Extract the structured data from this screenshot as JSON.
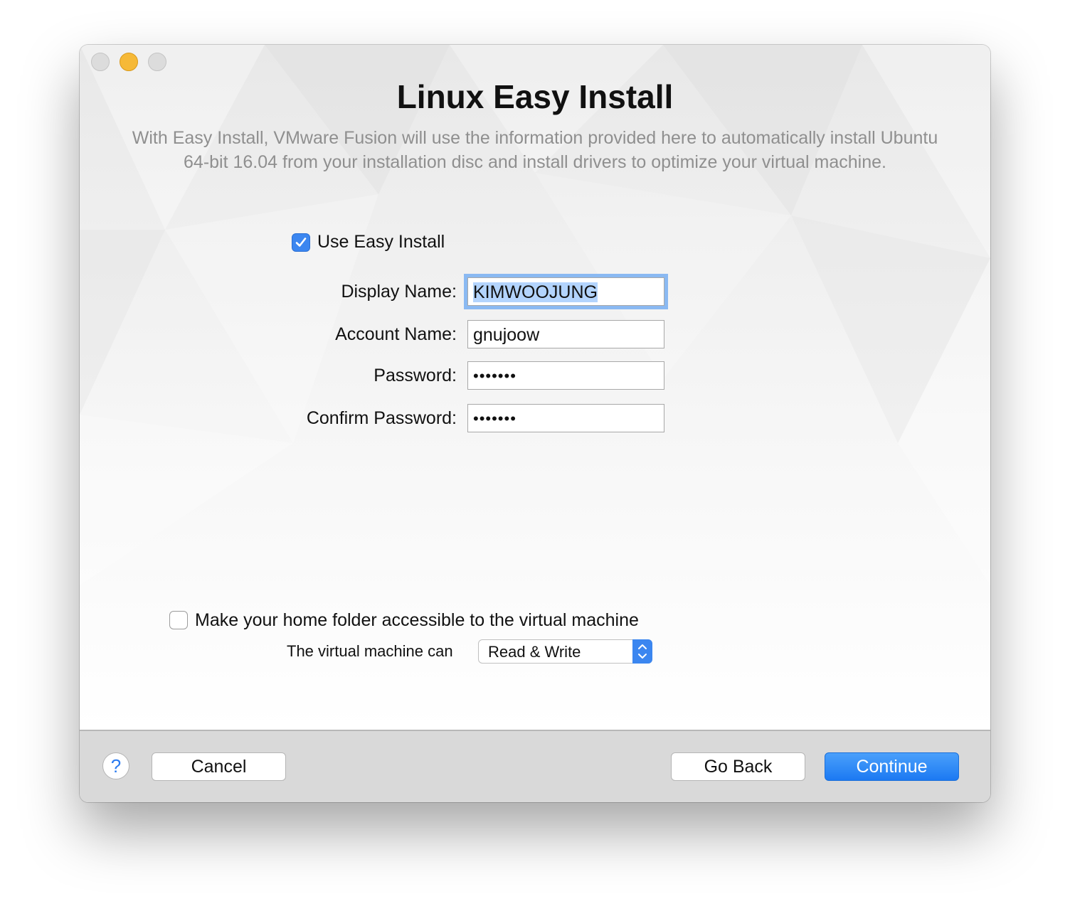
{
  "window": {
    "title": "Linux Easy Install",
    "description": "With Easy Install, VMware Fusion will use the information provided here to automatically install Ubuntu 64-bit 16.04 from your installation disc and install drivers to optimize your virtual machine."
  },
  "easy_install": {
    "label": "Use Easy Install",
    "checked": true
  },
  "form": {
    "display_name_label": "Display Name:",
    "display_name_value": "KIMWOOJUNG",
    "account_name_label": "Account Name:",
    "account_name_value": "gnujoow",
    "password_label": "Password:",
    "password_value": "•••••••",
    "confirm_password_label": "Confirm Password:",
    "confirm_password_value": "•••••••"
  },
  "sharing": {
    "home_folder_label": "Make your home folder accessible to the virtual machine",
    "home_folder_checked": false,
    "access_label": "The virtual machine can",
    "access_value": "Read & Write"
  },
  "footer": {
    "help_label": "?",
    "cancel_label": "Cancel",
    "go_back_label": "Go Back",
    "continue_label": "Continue"
  },
  "colors": {
    "accent": "#3b86f0",
    "minimize": "#f6b937",
    "selection": "#b3d4fd"
  }
}
